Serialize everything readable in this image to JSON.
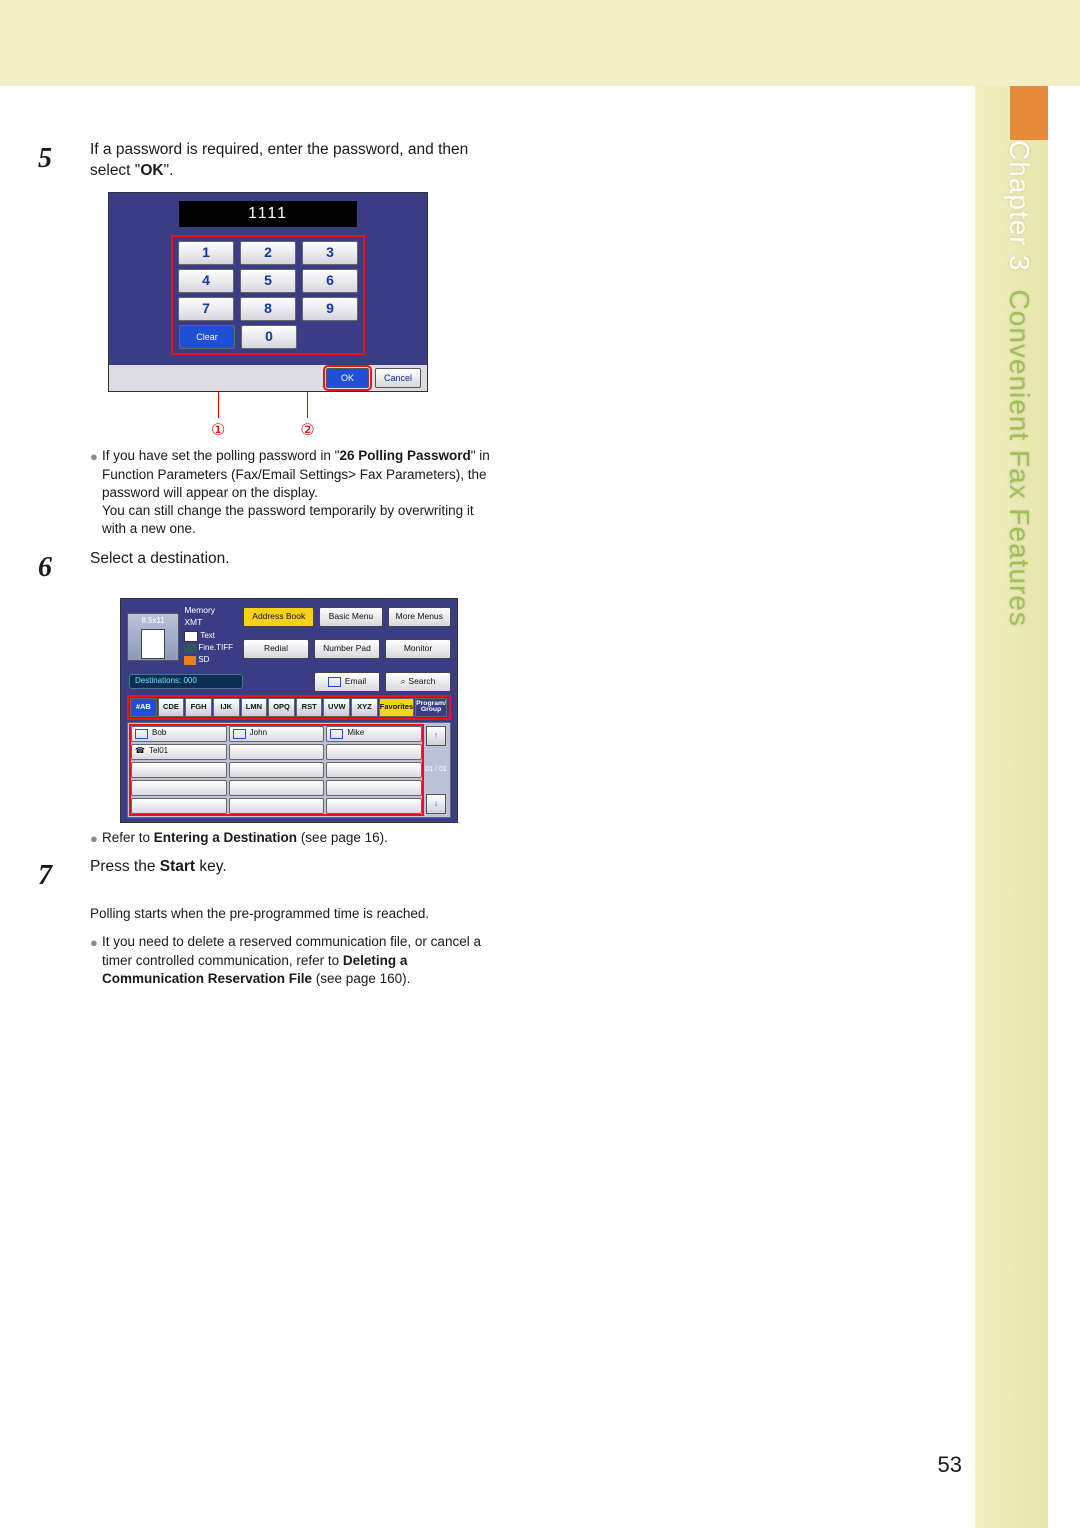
{
  "chapter": {
    "prefix": "Chapter",
    "number": "3",
    "title": "Convenient Fax Features"
  },
  "page_number": "53",
  "steps": {
    "s5": {
      "num": "5",
      "text_start": "If a password is required, enter the password, and then select \"",
      "ok_word": "OK",
      "text_end": "\"."
    },
    "s6": {
      "num": "6",
      "text": "Select a destination."
    },
    "s7": {
      "num": "7",
      "text_before": "Press the ",
      "bold": "Start",
      "text_after": " key.",
      "para": "Polling starts when the pre-programmed time is reached."
    }
  },
  "note5": {
    "before": "If you have set the polling password in \"",
    "bold1": "26 Polling Password",
    "mid": "\" in Function Parameters (Fax/Email Settings> Fax Parameters), the password will appear on the display.",
    "line2": "You can still change the password temporarily by overwriting it with a new one."
  },
  "note6": {
    "before": "Refer to ",
    "bold": "Entering a Destination",
    "after": " (see page 16)."
  },
  "note7": {
    "before": "It you need to delete a reserved communication file, or cancel a timer controlled communication, refer to ",
    "bold": "Deleting a Communication Reservation File",
    "after": " (see page 160)."
  },
  "keypad": {
    "display_value": "1111",
    "keys": [
      "1",
      "2",
      "3",
      "4",
      "5",
      "6",
      "7",
      "8",
      "9"
    ],
    "clear": "Clear",
    "zero": "0",
    "ok": "OK",
    "cancel": "Cancel",
    "callout1": "①",
    "callout2": "②"
  },
  "dest": {
    "paper": "8.5x11",
    "mode": "Memory XMT",
    "addr_book": "Address Book",
    "basic_menu": "Basic Menu",
    "more_menus": "More Menus",
    "text": "Text",
    "res": "Fine.TIFF",
    "redial": "Redial",
    "number_pad": "Number Pad",
    "monitor": "Monitor",
    "sd": "SD",
    "destinations": "Destinations: 000",
    "email": "Email",
    "search": "Search",
    "tabs": [
      "#AB",
      "CDE",
      "FGH",
      "IJK",
      "LMN",
      "OPQ",
      "RST",
      "UVW",
      "XYZ",
      "Favorites",
      "Program/\nGroup"
    ],
    "entries": [
      "Bob",
      "John",
      "Mike",
      "Tel01"
    ],
    "pos": "01\n/\n01"
  }
}
